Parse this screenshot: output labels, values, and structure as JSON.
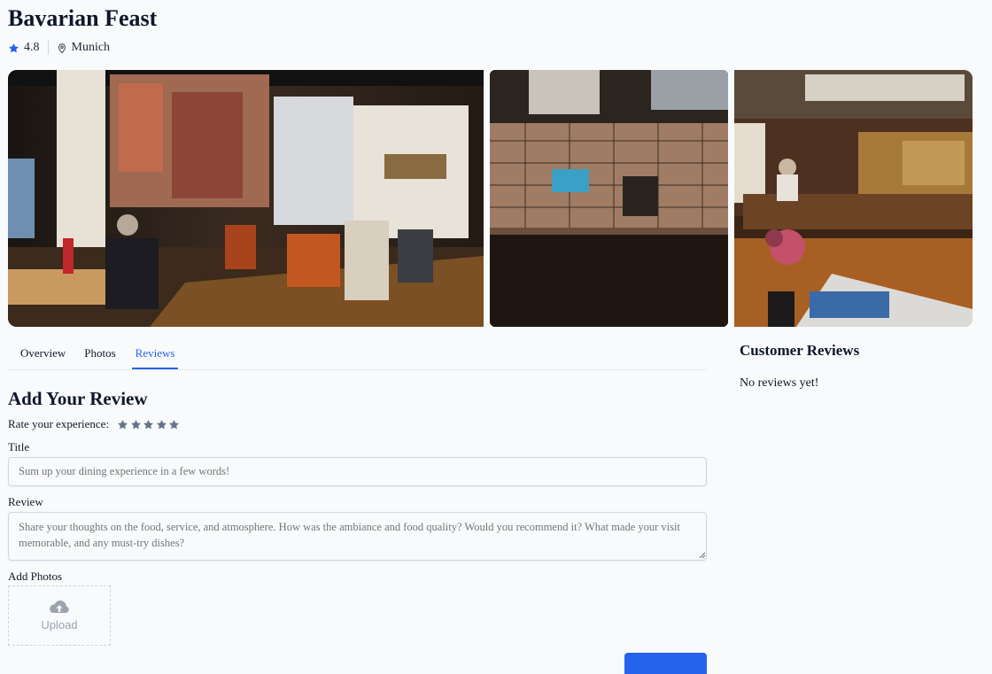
{
  "restaurant": {
    "name": "Bavarian Feast",
    "rating": "4.8",
    "location": "Munich"
  },
  "gallery": {
    "images": [
      {
        "icon": "restaurant-interior-photo"
      },
      {
        "icon": "kitchen-counter-photo"
      },
      {
        "icon": "beer-hall-table-photo"
      }
    ]
  },
  "tabs": [
    {
      "label": "Overview",
      "active": false
    },
    {
      "label": "Photos",
      "active": false
    },
    {
      "label": "Reviews",
      "active": true
    }
  ],
  "review_form": {
    "heading": "Add Your Review",
    "rate_label": "Rate your experience:",
    "star_count": 5,
    "title_label": "Title",
    "title_placeholder": "Sum up your dining experience in a few words!",
    "review_label": "Review",
    "review_placeholder": "Share your thoughts on the food, service, and atmosphere. How was the ambiance and food quality? Would you recommend it? What made your visit memorable, and any must-try dishes?",
    "photos_label": "Add Photos",
    "upload_label": "Upload"
  },
  "customer_reviews": {
    "heading": "Customer Reviews",
    "empty_text": "No reviews yet!"
  },
  "colors": {
    "accent": "#2563eb",
    "star_rating": "#2563eb",
    "star_empty": "#64748b",
    "background": "#f8fafc"
  }
}
